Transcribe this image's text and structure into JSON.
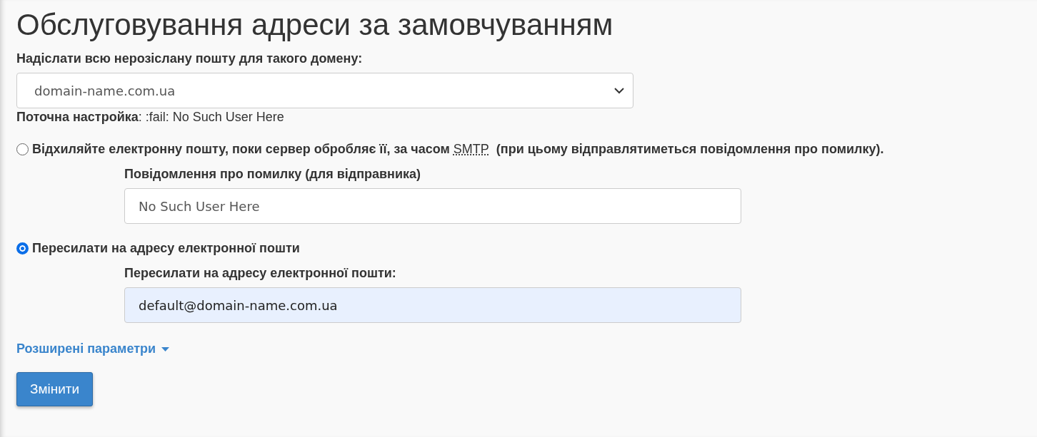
{
  "title": "Обслуговування адреси за замовчуванням",
  "domain_select": {
    "label": "Надіслати всю нерозіслану пошту для такого домену:",
    "value": "domain-name.com.ua"
  },
  "current_setting": "**Поточна настройка**: :fail: No Such User Here",
  "options": [
    {
      "kind": "reject",
      "selected": false,
      "label_before": "Відхиляйте електронну пошту, поки сервер обробляє її, за часом",
      "abbr": "SMTP",
      "label_after": "(при цьому відправлятиметься повідомлення про помилку).",
      "field": {
        "label": "Повідомлення про помилку (для відправника)",
        "value": "No Such User Here",
        "autofilled": false
      }
    },
    {
      "kind": "forward",
      "selected": true,
      "label_before": "Пересилати на адресу електронної пошти",
      "field": {
        "label": "Пересилати на адресу електронної пошти:",
        "value": "default@domain-name.com.ua",
        "autofilled": true
      }
    }
  ],
  "advanced_link": "Розширені параметри",
  "submit_button": "Змінити"
}
